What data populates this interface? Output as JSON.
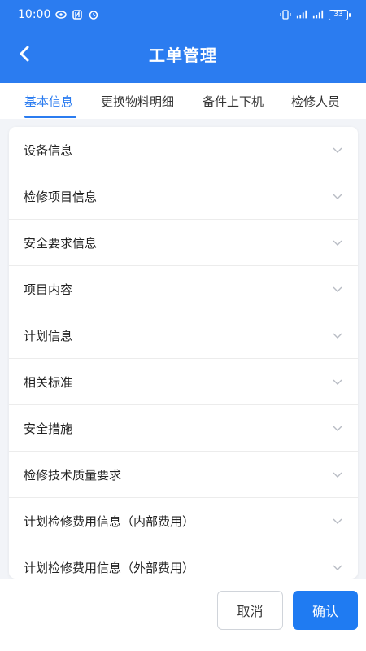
{
  "status_bar": {
    "time": "10:00",
    "battery": "33"
  },
  "header": {
    "title": "工单管理"
  },
  "tabs": [
    {
      "label": "基本信息",
      "active": true
    },
    {
      "label": "更换物料明细",
      "active": false
    },
    {
      "label": "备件上下机",
      "active": false
    },
    {
      "label": "检修人员",
      "active": false
    }
  ],
  "sections": [
    {
      "label": "设备信息"
    },
    {
      "label": "检修项目信息"
    },
    {
      "label": "安全要求信息"
    },
    {
      "label": "项目内容"
    },
    {
      "label": "计划信息"
    },
    {
      "label": "相关标准"
    },
    {
      "label": "安全措施"
    },
    {
      "label": "检修技术质量要求"
    },
    {
      "label": "计划检修费用信息（内部费用）"
    },
    {
      "label": "计划检修费用信息（外部费用）"
    }
  ],
  "footer": {
    "cancel_label": "取消",
    "confirm_label": "确认"
  },
  "colors": {
    "primary": "#2b7cf0",
    "confirm": "#1f7bf2"
  }
}
